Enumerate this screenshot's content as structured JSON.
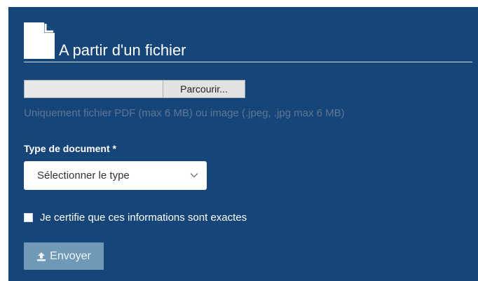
{
  "header": {
    "icon": "document-icon",
    "title": "A partir d'un fichier"
  },
  "file_input": {
    "browse_label": "Parcourir...",
    "hint": "Uniquement fichier PDF (max 6 MB) ou image (.jpeg, .jpg max 6 MB)"
  },
  "document_type": {
    "label": "Type de document *",
    "placeholder": "Sélectionner le type",
    "icon": "chevron-down-icon"
  },
  "certify": {
    "label": "Je certifie que ces informations sont exactes",
    "checked": false
  },
  "submit": {
    "label": "Envoyer",
    "icon": "upload-icon"
  },
  "colors": {
    "panel_bg": "#16457a",
    "button_disabled": "#7099b7",
    "hint_text": "#5e7895"
  }
}
